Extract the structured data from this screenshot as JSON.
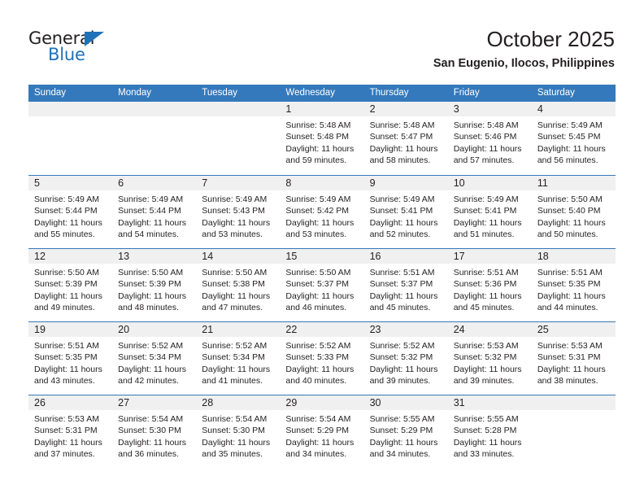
{
  "brand": {
    "name_top": "General",
    "name_bottom": "Blue",
    "triangle_color": "#1f72b8"
  },
  "header": {
    "month_title": "October 2025",
    "location": "San Eugenio, Ilocos, Philippines"
  },
  "theme": {
    "header_blue": "#3479bb",
    "day_strip_gray": "#f0f0f0",
    "text_color": "#231f20"
  },
  "weekdays": [
    "Sunday",
    "Monday",
    "Tuesday",
    "Wednesday",
    "Thursday",
    "Friday",
    "Saturday"
  ],
  "weeks": [
    [
      {
        "day": "",
        "empty": true,
        "lines": []
      },
      {
        "day": "",
        "empty": true,
        "lines": []
      },
      {
        "day": "",
        "empty": true,
        "lines": []
      },
      {
        "day": "1",
        "empty": false,
        "lines": [
          "Sunrise: 5:48 AM",
          "Sunset: 5:48 PM",
          "Daylight: 11 hours",
          "and 59 minutes."
        ]
      },
      {
        "day": "2",
        "empty": false,
        "lines": [
          "Sunrise: 5:48 AM",
          "Sunset: 5:47 PM",
          "Daylight: 11 hours",
          "and 58 minutes."
        ]
      },
      {
        "day": "3",
        "empty": false,
        "lines": [
          "Sunrise: 5:48 AM",
          "Sunset: 5:46 PM",
          "Daylight: 11 hours",
          "and 57 minutes."
        ]
      },
      {
        "day": "4",
        "empty": false,
        "lines": [
          "Sunrise: 5:49 AM",
          "Sunset: 5:45 PM",
          "Daylight: 11 hours",
          "and 56 minutes."
        ]
      }
    ],
    [
      {
        "day": "5",
        "empty": false,
        "lines": [
          "Sunrise: 5:49 AM",
          "Sunset: 5:44 PM",
          "Daylight: 11 hours",
          "and 55 minutes."
        ]
      },
      {
        "day": "6",
        "empty": false,
        "lines": [
          "Sunrise: 5:49 AM",
          "Sunset: 5:44 PM",
          "Daylight: 11 hours",
          "and 54 minutes."
        ]
      },
      {
        "day": "7",
        "empty": false,
        "lines": [
          "Sunrise: 5:49 AM",
          "Sunset: 5:43 PM",
          "Daylight: 11 hours",
          "and 53 minutes."
        ]
      },
      {
        "day": "8",
        "empty": false,
        "lines": [
          "Sunrise: 5:49 AM",
          "Sunset: 5:42 PM",
          "Daylight: 11 hours",
          "and 53 minutes."
        ]
      },
      {
        "day": "9",
        "empty": false,
        "lines": [
          "Sunrise: 5:49 AM",
          "Sunset: 5:41 PM",
          "Daylight: 11 hours",
          "and 52 minutes."
        ]
      },
      {
        "day": "10",
        "empty": false,
        "lines": [
          "Sunrise: 5:49 AM",
          "Sunset: 5:41 PM",
          "Daylight: 11 hours",
          "and 51 minutes."
        ]
      },
      {
        "day": "11",
        "empty": false,
        "lines": [
          "Sunrise: 5:50 AM",
          "Sunset: 5:40 PM",
          "Daylight: 11 hours",
          "and 50 minutes."
        ]
      }
    ],
    [
      {
        "day": "12",
        "empty": false,
        "lines": [
          "Sunrise: 5:50 AM",
          "Sunset: 5:39 PM",
          "Daylight: 11 hours",
          "and 49 minutes."
        ]
      },
      {
        "day": "13",
        "empty": false,
        "lines": [
          "Sunrise: 5:50 AM",
          "Sunset: 5:39 PM",
          "Daylight: 11 hours",
          "and 48 minutes."
        ]
      },
      {
        "day": "14",
        "empty": false,
        "lines": [
          "Sunrise: 5:50 AM",
          "Sunset: 5:38 PM",
          "Daylight: 11 hours",
          "and 47 minutes."
        ]
      },
      {
        "day": "15",
        "empty": false,
        "lines": [
          "Sunrise: 5:50 AM",
          "Sunset: 5:37 PM",
          "Daylight: 11 hours",
          "and 46 minutes."
        ]
      },
      {
        "day": "16",
        "empty": false,
        "lines": [
          "Sunrise: 5:51 AM",
          "Sunset: 5:37 PM",
          "Daylight: 11 hours",
          "and 45 minutes."
        ]
      },
      {
        "day": "17",
        "empty": false,
        "lines": [
          "Sunrise: 5:51 AM",
          "Sunset: 5:36 PM",
          "Daylight: 11 hours",
          "and 45 minutes."
        ]
      },
      {
        "day": "18",
        "empty": false,
        "lines": [
          "Sunrise: 5:51 AM",
          "Sunset: 5:35 PM",
          "Daylight: 11 hours",
          "and 44 minutes."
        ]
      }
    ],
    [
      {
        "day": "19",
        "empty": false,
        "lines": [
          "Sunrise: 5:51 AM",
          "Sunset: 5:35 PM",
          "Daylight: 11 hours",
          "and 43 minutes."
        ]
      },
      {
        "day": "20",
        "empty": false,
        "lines": [
          "Sunrise: 5:52 AM",
          "Sunset: 5:34 PM",
          "Daylight: 11 hours",
          "and 42 minutes."
        ]
      },
      {
        "day": "21",
        "empty": false,
        "lines": [
          "Sunrise: 5:52 AM",
          "Sunset: 5:34 PM",
          "Daylight: 11 hours",
          "and 41 minutes."
        ]
      },
      {
        "day": "22",
        "empty": false,
        "lines": [
          "Sunrise: 5:52 AM",
          "Sunset: 5:33 PM",
          "Daylight: 11 hours",
          "and 40 minutes."
        ]
      },
      {
        "day": "23",
        "empty": false,
        "lines": [
          "Sunrise: 5:52 AM",
          "Sunset: 5:32 PM",
          "Daylight: 11 hours",
          "and 39 minutes."
        ]
      },
      {
        "day": "24",
        "empty": false,
        "lines": [
          "Sunrise: 5:53 AM",
          "Sunset: 5:32 PM",
          "Daylight: 11 hours",
          "and 39 minutes."
        ]
      },
      {
        "day": "25",
        "empty": false,
        "lines": [
          "Sunrise: 5:53 AM",
          "Sunset: 5:31 PM",
          "Daylight: 11 hours",
          "and 38 minutes."
        ]
      }
    ],
    [
      {
        "day": "26",
        "empty": false,
        "lines": [
          "Sunrise: 5:53 AM",
          "Sunset: 5:31 PM",
          "Daylight: 11 hours",
          "and 37 minutes."
        ]
      },
      {
        "day": "27",
        "empty": false,
        "lines": [
          "Sunrise: 5:54 AM",
          "Sunset: 5:30 PM",
          "Daylight: 11 hours",
          "and 36 minutes."
        ]
      },
      {
        "day": "28",
        "empty": false,
        "lines": [
          "Sunrise: 5:54 AM",
          "Sunset: 5:30 PM",
          "Daylight: 11 hours",
          "and 35 minutes."
        ]
      },
      {
        "day": "29",
        "empty": false,
        "lines": [
          "Sunrise: 5:54 AM",
          "Sunset: 5:29 PM",
          "Daylight: 11 hours",
          "and 34 minutes."
        ]
      },
      {
        "day": "30",
        "empty": false,
        "lines": [
          "Sunrise: 5:55 AM",
          "Sunset: 5:29 PM",
          "Daylight: 11 hours",
          "and 34 minutes."
        ]
      },
      {
        "day": "31",
        "empty": false,
        "lines": [
          "Sunrise: 5:55 AM",
          "Sunset: 5:28 PM",
          "Daylight: 11 hours",
          "and 33 minutes."
        ]
      },
      {
        "day": "",
        "empty": true,
        "lines": []
      }
    ]
  ]
}
